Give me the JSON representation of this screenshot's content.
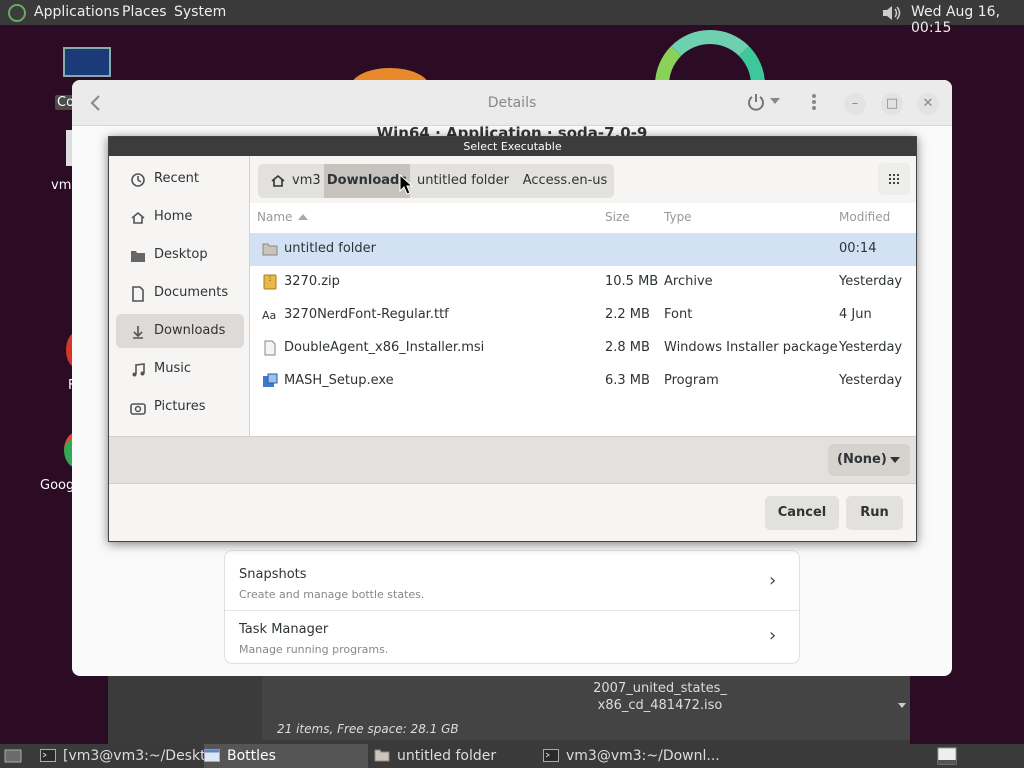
{
  "top_panel": {
    "menus": [
      "Applications",
      "Places",
      "System"
    ],
    "clock": "Wed Aug 16, 00:15"
  },
  "desktop": {
    "icons": [
      "Co",
      "vm3",
      "F",
      "Goog"
    ]
  },
  "bottles": {
    "title": "Details",
    "subtitle": "Win64 · Application · soda-7.0-9",
    "rows": [
      {
        "title": "Snapshots",
        "subtitle": "Create and manage bottle states."
      },
      {
        "title": "Task Manager",
        "subtitle": "Manage running programs."
      }
    ]
  },
  "file_manager": {
    "iso_name": "2007_united_states_\nx86_cd_481472.iso",
    "status": "21 items, Free space: 28.1 GB"
  },
  "dialog": {
    "title": "Select Executable",
    "sidebar": [
      {
        "label": "Recent",
        "icon": "clock-icon"
      },
      {
        "label": "Home",
        "icon": "home-icon"
      },
      {
        "label": "Desktop",
        "icon": "folder-icon"
      },
      {
        "label": "Documents",
        "icon": "document-icon"
      },
      {
        "label": "Downloads",
        "icon": "download-icon",
        "selected": true
      },
      {
        "label": "Music",
        "icon": "music-icon"
      },
      {
        "label": "Pictures",
        "icon": "camera-icon"
      }
    ],
    "path": [
      "vm3",
      "Downloads",
      "untitled folder",
      "Access.en-us"
    ],
    "columns": {
      "name": "Name",
      "size": "Size",
      "type": "Type",
      "modified": "Modified"
    },
    "files": [
      {
        "name": "untitled folder",
        "size": "",
        "type": "",
        "modified": "00:14",
        "icon": "folder-icon",
        "selected": true
      },
      {
        "name": "3270.zip",
        "size": "10.5 MB",
        "type": "Archive",
        "modified": "Yesterday",
        "icon": "archive-icon"
      },
      {
        "name": "3270NerdFont-Regular.ttf",
        "size": "2.2 MB",
        "type": "Font",
        "modified": "4 Jun",
        "icon": "font-icon"
      },
      {
        "name": "DoubleAgent_x86_Installer.msi",
        "size": "2.8 MB",
        "type": "Windows Installer package",
        "modified": "Yesterday",
        "icon": "document-icon"
      },
      {
        "name": "MASH_Setup.exe",
        "size": "6.3 MB",
        "type": "Program",
        "modified": "Yesterday",
        "icon": "program-icon"
      }
    ],
    "filter": "(None)",
    "cancel": "Cancel",
    "run": "Run"
  },
  "taskbar": {
    "tasks": [
      "[vm3@vm3:~/Deskt...",
      "Bottles",
      "untitled folder",
      "vm3@vm3:~/Downl..."
    ]
  }
}
